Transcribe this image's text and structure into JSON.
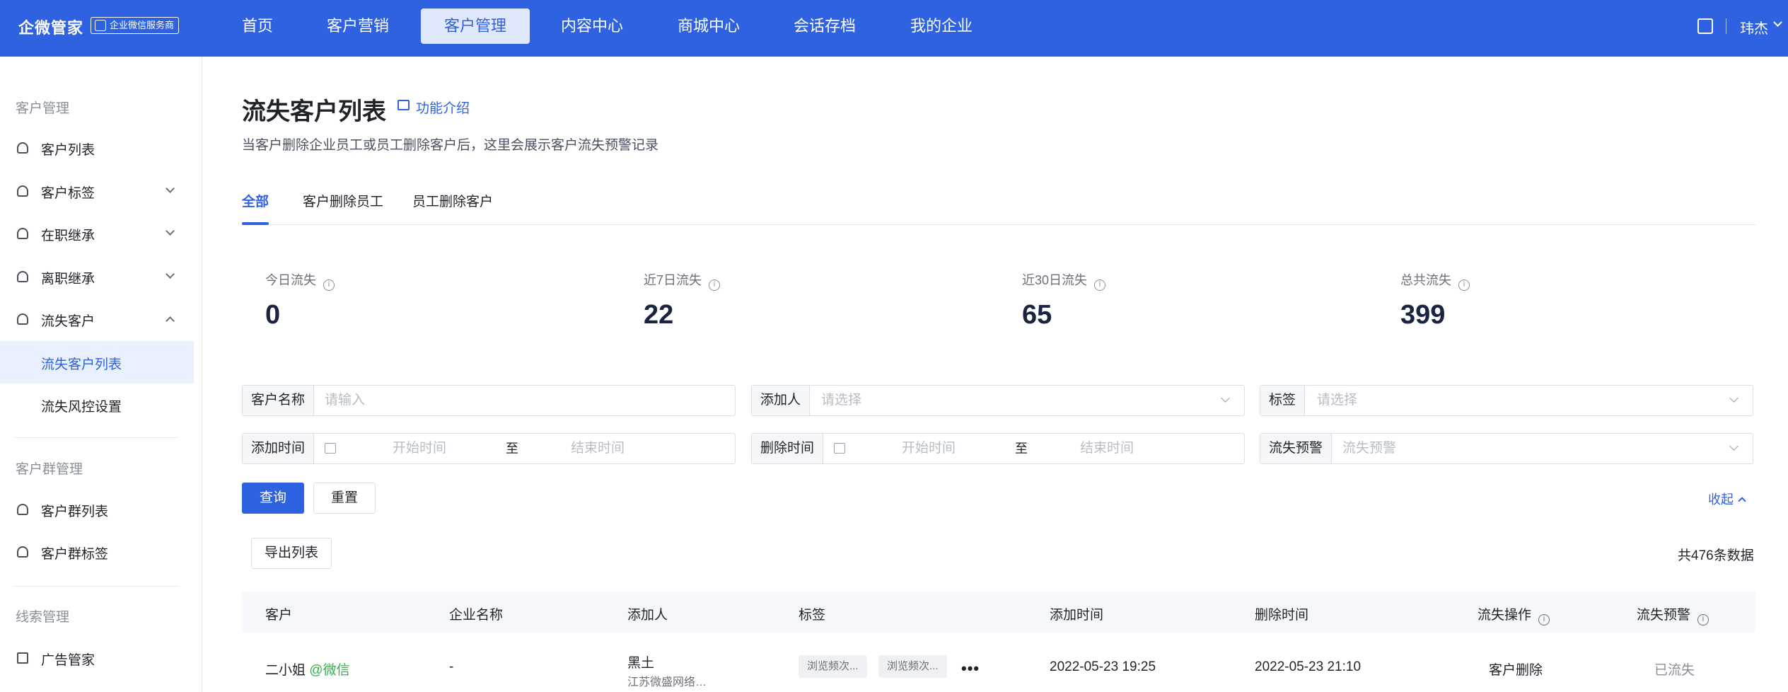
{
  "topbar": {
    "brand": "企微管家",
    "badge": "企业微信服务商",
    "nav": [
      "首页",
      "客户营销",
      "客户管理",
      "内容中心",
      "商城中心",
      "会话存档",
      "我的企业"
    ],
    "active_nav": "客户管理",
    "user": "玮杰"
  },
  "sidebar": {
    "group1": "客户管理",
    "items1": [
      {
        "label": "客户列表",
        "icon": "user-icon",
        "chevron": ""
      },
      {
        "label": "客户标签",
        "icon": "user-tag-icon",
        "chevron": "down"
      },
      {
        "label": "在职继承",
        "icon": "login-icon",
        "chevron": "down"
      },
      {
        "label": "离职继承",
        "icon": "logout-icon",
        "chevron": "down"
      },
      {
        "label": "流失客户",
        "icon": "user-icon",
        "chevron": "up"
      }
    ],
    "sub_items": [
      "流失客户列表",
      "流失风控设置"
    ],
    "active_sub": "流失客户列表",
    "group2": "客户群管理",
    "items2": [
      {
        "label": "客户群列表",
        "icon": "group-icon"
      },
      {
        "label": "客户群标签",
        "icon": "group-tag-icon"
      }
    ],
    "group3": "线索管理",
    "items3": [
      {
        "label": "广告管家",
        "icon": "ad-icon"
      }
    ]
  },
  "page": {
    "title": "流失客户列表",
    "intro_link": "功能介绍",
    "description": "当客户删除企业员工或员工删除客户后，这里会展示客户流失预警记录"
  },
  "tabs": [
    "全部",
    "客户删除员工",
    "员工删除客户"
  ],
  "active_tab": "全部",
  "stats": [
    {
      "label": "今日流失",
      "value": "0"
    },
    {
      "label": "近7日流失",
      "value": "22"
    },
    {
      "label": "近30日流失",
      "value": "65"
    },
    {
      "label": "总共流失",
      "value": "399"
    }
  ],
  "filters": {
    "customer_name": {
      "label": "客户名称",
      "placeholder": "请输入"
    },
    "adder": {
      "label": "添加人",
      "placeholder": "请选择"
    },
    "tag": {
      "label": "标签",
      "placeholder": "请选择"
    },
    "add_time": {
      "label": "添加时间",
      "start": "开始时间",
      "to": "至",
      "end": "结束时间"
    },
    "delete_time": {
      "label": "删除时间",
      "start": "开始时间",
      "to": "至",
      "end": "结束时间"
    },
    "churn_alert": {
      "label": "流失预警",
      "placeholder": "流失预警"
    }
  },
  "buttons": {
    "query": "查询",
    "reset": "重置",
    "collapse": "收起",
    "export": "导出列表"
  },
  "total": "共476条数据",
  "table": {
    "columns": [
      "客户",
      "企业名称",
      "添加人",
      "标签",
      "添加时间",
      "删除时间",
      "流失操作",
      "流失预警"
    ],
    "rows": [
      {
        "customer": "二小姐",
        "customer_suffix": "@微信",
        "company": "-",
        "adder": "黑土",
        "adder_company": "江苏微盛网络…",
        "tags": [
          "浏览频次...",
          "浏览频次..."
        ],
        "more": "•••",
        "add_time": "2022-05-23 19:25",
        "delete_time": "2022-05-23 21:10",
        "churn_action": "客户删除",
        "churn_alert": "已流失"
      }
    ]
  },
  "colors": {
    "primary": "#2f62e0",
    "wechat_green": "#2fb24a",
    "header_bg": "#f5f7fa"
  }
}
